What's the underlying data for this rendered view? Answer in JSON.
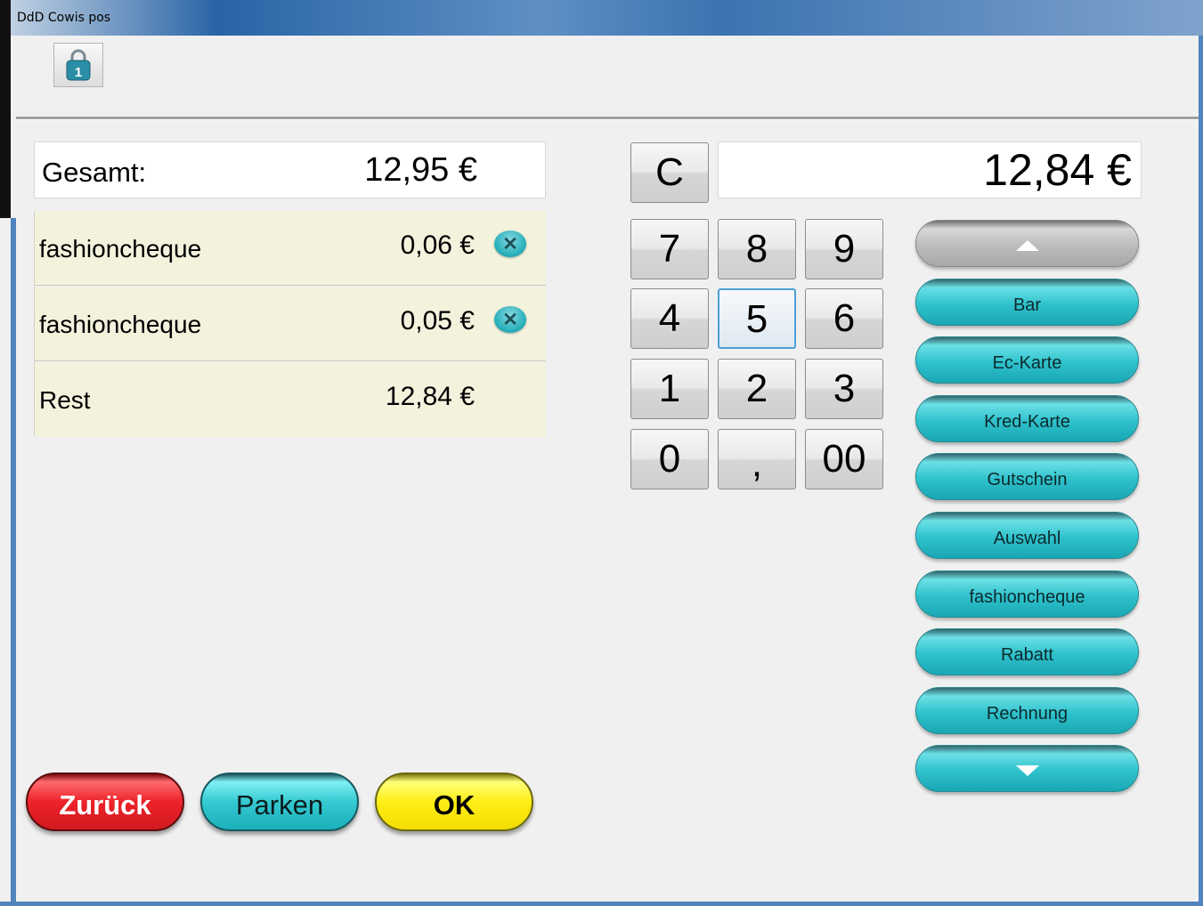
{
  "window": {
    "title": "DdD Cowis pos"
  },
  "toolbar": {
    "lock_badge": "1"
  },
  "total": {
    "label": "Gesamt:",
    "value": "12,95 €"
  },
  "payments": [
    {
      "name": "fashioncheque",
      "amount": "0,06 €"
    },
    {
      "name": "fashioncheque",
      "amount": "0,05 €"
    }
  ],
  "delete_glyph": "✕",
  "rest": {
    "label": "Rest",
    "value": "12,84 €"
  },
  "keypad": {
    "clear": "C",
    "display": "12,84 €",
    "keys": [
      "7",
      "8",
      "9",
      "4",
      "5",
      "6",
      "1",
      "2",
      "3",
      "0",
      ",",
      "00"
    ],
    "selected_key": "5"
  },
  "payment_methods": [
    "Bar",
    "Ec-Karte",
    "Kred-Karte",
    "Gutschein",
    "Auswahl",
    "fashioncheque",
    "Rabatt",
    "Rechnung"
  ],
  "actions": {
    "back": "Zurück",
    "park": "Parken",
    "ok": "OK"
  },
  "colors": {
    "method_button": "#2fc2cc",
    "back_button": "#ec2229",
    "park_button": "#35c9d1",
    "ok_button": "#ffee14",
    "row_background": "#f3f2dd"
  }
}
